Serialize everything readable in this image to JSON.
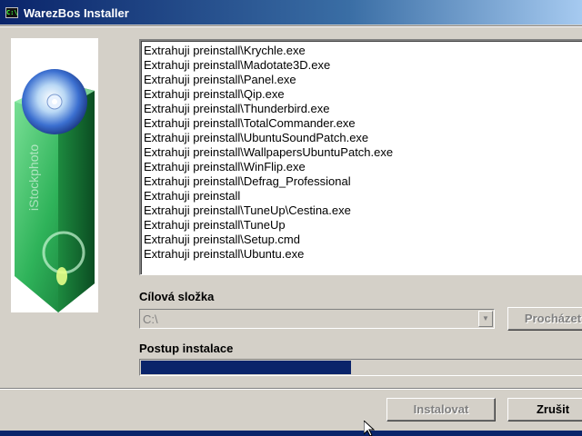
{
  "window": {
    "title": "WarezBos Installer",
    "icon": "console-app-icon"
  },
  "side_image": {
    "watermark": "iStockphoto"
  },
  "file_list": {
    "items": [
      "Extrahuji preinstall\\Krychle.exe",
      "Extrahuji preinstall\\Madotate3D.exe",
      "Extrahuji preinstall\\Panel.exe",
      "Extrahuji preinstall\\Qip.exe",
      "Extrahuji preinstall\\Thunderbird.exe",
      "Extrahuji preinstall\\TotalCommander.exe",
      "Extrahuji preinstall\\UbuntuSoundPatch.exe",
      "Extrahuji preinstall\\WallpapersUbuntuPatch.exe",
      "Extrahuji preinstall\\WinFlip.exe",
      "Extrahuji preinstall\\Defrag_Professional",
      "Extrahuji preinstall",
      "Extrahuji preinstall\\TuneUp\\Cestina.exe",
      "Extrahuji preinstall\\TuneUp",
      "Extrahuji preinstall\\Setup.cmd",
      "Extrahuji preinstall\\Ubuntu.exe"
    ]
  },
  "target": {
    "label": "Cílová složka",
    "value": "C:\\",
    "browse_label": "Procházet"
  },
  "progress": {
    "label": "Postup instalace",
    "fraction": 0.465
  },
  "buttons": {
    "install_label": "Instalovat",
    "cancel_label": "Zrušit"
  },
  "colors": {
    "titlebar_start": "#0a246a",
    "progress_fill": "#0a246a",
    "dialog_face": "#d4d0c8"
  }
}
